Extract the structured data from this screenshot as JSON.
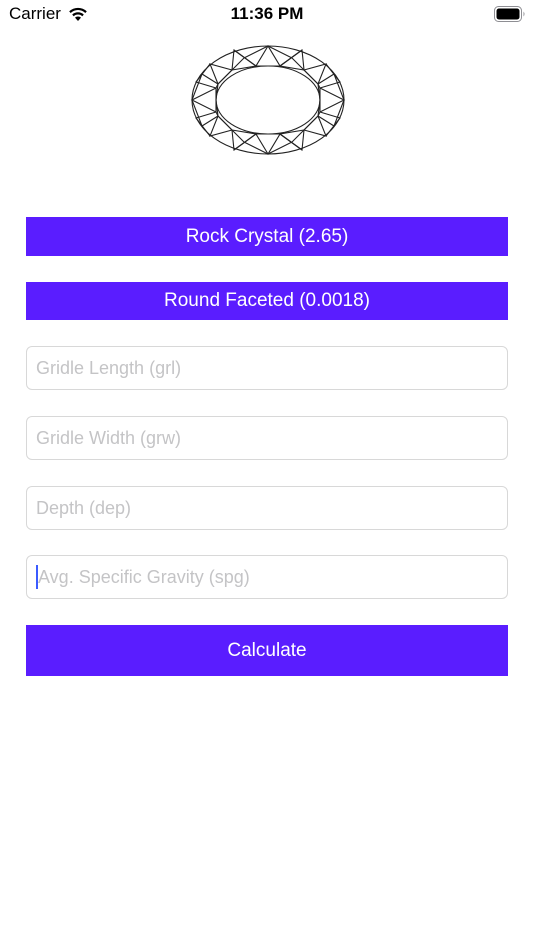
{
  "status_bar": {
    "carrier": "Carrier",
    "time": "11:36 PM"
  },
  "buttons": {
    "material": "Rock Crystal (2.65)",
    "cut": "Round Faceted (0.0018)",
    "calculate": "Calculate"
  },
  "fields": {
    "girdle_length_placeholder": "Gridle Length (grl)",
    "girdle_width_placeholder": "Gridle Width (grw)",
    "depth_placeholder": "Depth (dep)",
    "spg_placeholder": "Avg. Specific Gravity (spg)"
  },
  "colors": {
    "accent": "#5a1dff",
    "caret": "#3b5bff"
  },
  "icons": {
    "wifi": "wifi-icon",
    "battery": "battery-icon",
    "gem": "oval-faceted-gem-diagram"
  }
}
